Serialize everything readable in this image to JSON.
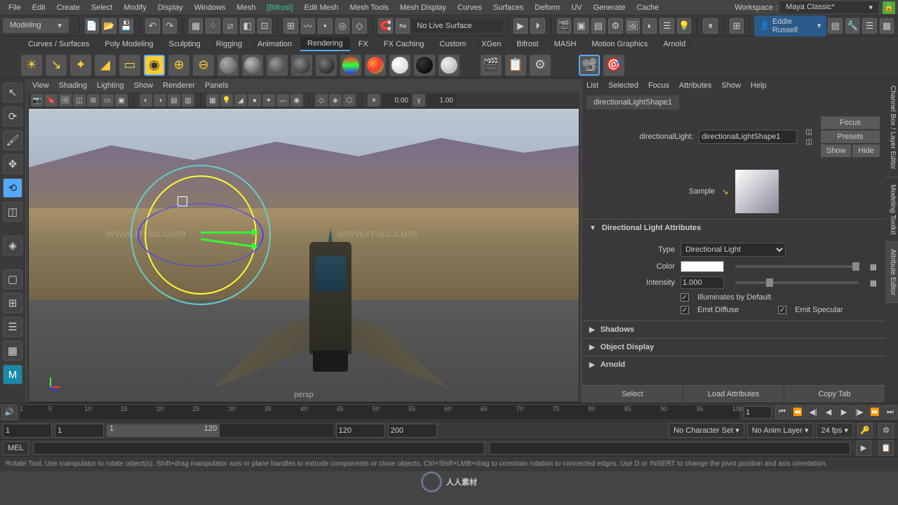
{
  "menubar": [
    "File",
    "Edit",
    "Create",
    "Select",
    "Modify",
    "Display",
    "Windows",
    "Mesh",
    "[Bifrost]",
    "Edit Mesh",
    "Mesh Tools",
    "Mesh Display",
    "Curves",
    "Surfaces",
    "Deform",
    "UV",
    "Generate",
    "Cache"
  ],
  "workspace": {
    "label": "Workspace :",
    "value": "Maya Classic*"
  },
  "mode": "Modeling",
  "live_surface": "No Live Surface",
  "user": "Eddie Russell",
  "shelf_tabs": [
    "Curves / Surfaces",
    "Poly Modeling",
    "Sculpting",
    "Rigging",
    "Animation",
    "Rendering",
    "FX",
    "FX Caching",
    "Custom",
    "XGen",
    "Bifrost",
    "MASH",
    "Motion Graphics",
    "Arnold"
  ],
  "shelf_active": "Rendering",
  "vp_menu": [
    "View",
    "Shading",
    "Lighting",
    "Show",
    "Renderer",
    "Panels"
  ],
  "vp_num1": "0.00",
  "vp_num2": "1.00",
  "persp": "persp",
  "attr_menu": [
    "List",
    "Selected",
    "Focus",
    "Attributes",
    "Show",
    "Help"
  ],
  "attr_tab": "directionalLightShape1",
  "attr_field": {
    "label": "directionalLight:",
    "value": "directionalLightShape1"
  },
  "attr_buttons": {
    "focus": "Focus",
    "presets": "Presets",
    "show": "Show",
    "hide": "Hide"
  },
  "sample": "Sample",
  "sect_attrs": "Directional Light Attributes",
  "type": {
    "label": "Type",
    "value": "Directional Light"
  },
  "color": {
    "label": "Color"
  },
  "intensity": {
    "label": "Intensity",
    "value": "1.000"
  },
  "illum": "Illuminates by Default",
  "diffuse": "Emit Diffuse",
  "specular": "Emit Specular",
  "sect_shadows": "Shadows",
  "sect_objdisp": "Object Display",
  "sect_arnold": "Arnold",
  "footer": {
    "select": "Select",
    "load": "Load Attributes",
    "copy": "Copy Tab"
  },
  "rtabs": [
    "Channel Box / Layer Editor",
    "Modeling Toolkit",
    "Attribute Editor"
  ],
  "tl_ticks": [
    "1",
    "5",
    "10",
    "15",
    "20",
    "25",
    "30",
    "35",
    "40",
    "45",
    "50",
    "55",
    "60",
    "65",
    "70",
    "75",
    "80",
    "85",
    "90",
    "95",
    "100"
  ],
  "tl_current": "1",
  "range": {
    "a": "1",
    "b": "1",
    "c": "1",
    "d": "120",
    "e": "120",
    "f": "200"
  },
  "charset": "No Character Set",
  "animlayer": "No Anim Layer",
  "fps": "24 fps",
  "cmd_label": "MEL",
  "status": "Rotate Tool: Use manipulator to rotate object(s). Shift+drag manipulator axis or plane handles to extrude components or clone objects. Ctrl+Shift+LMB+drag to constrain rotation to connected edges. Use D or INSERT to change the pivot position and axis orientation.",
  "wm": "www.rr-sc.com",
  "wm_big": "人人素材"
}
